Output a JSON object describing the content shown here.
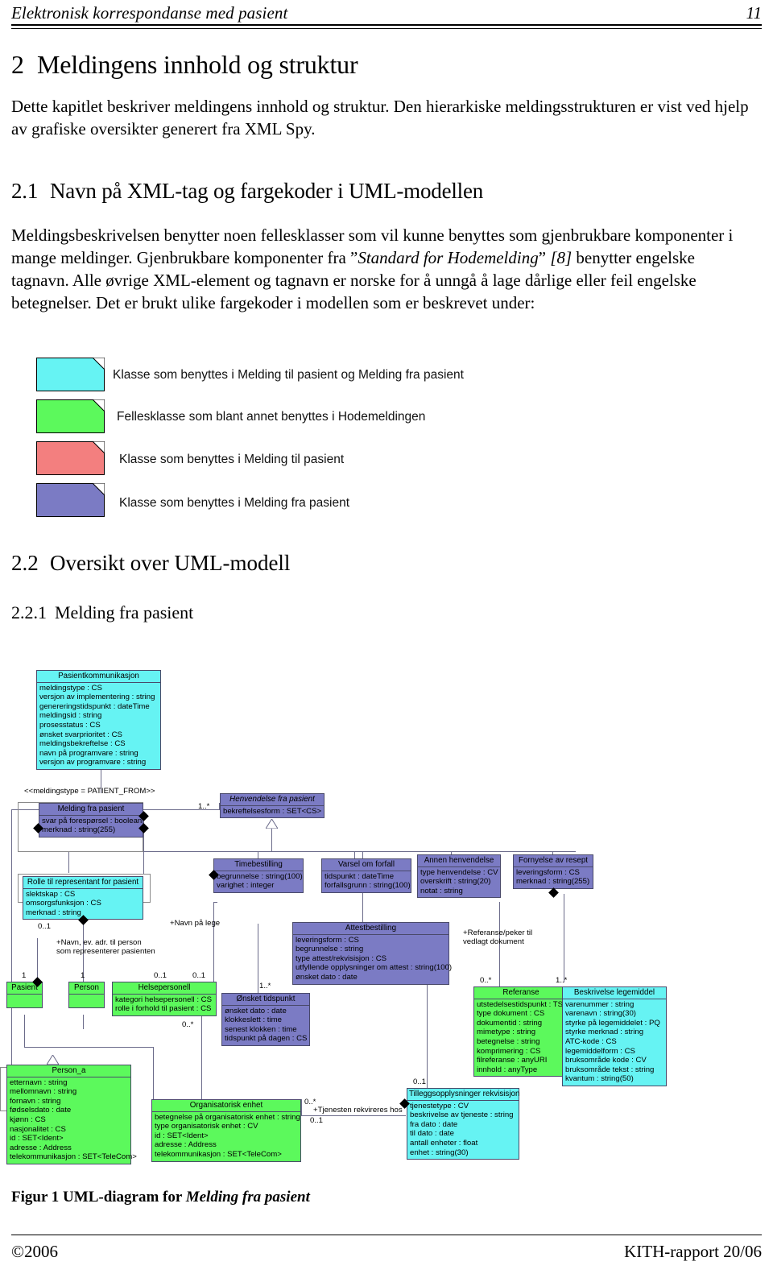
{
  "header": {
    "running_title": "Elektronisk korrespondanse med pasient",
    "page_number": "11"
  },
  "footer": {
    "copyright": "©2006",
    "report_id": "KITH-rapport 20/06"
  },
  "sections": {
    "h1_number": "2",
    "h1_title": "Meldingens innhold og struktur",
    "intro": "Dette kapitlet beskriver meldingens innhold og struktur. Den hierarkiske meldingsstrukturen er vist ved hjelp av grafiske oversikter generert fra XML Spy.",
    "h2_number": "2.1",
    "h2_title": "Navn på XML-tag og fargekoder i UML-modellen",
    "p21_a": "Meldingsbeskrivelsen benytter noen fellesklasser som vil kunne benyttes som gjenbrukbare komponenter i mange meldinger. Gjenbrukbare komponenter fra ”",
    "p21_i1": "Standard for Hodemelding",
    "p21_b": "” ",
    "p21_i2": "[8]",
    "p21_c": " benytter engelske tagnavn. Alle øvrige XML-element og tagnavn er norske for å unngå å lage dårlige eller feil engelske betegnelser. Det er brukt ulike fargekoder i modellen som er beskrevet under:",
    "h2b_number": "2.2",
    "h2b_title": "Oversikt over UML-modell",
    "h3_number": "2.2.1",
    "h3_title": "Melding fra pasient"
  },
  "legend": {
    "items": [
      {
        "color": "#66f3f3",
        "label": "Klasse som benyttes i Melding til pasient og Melding fra pasient"
      },
      {
        "color": "#5cf95c",
        "label": "Fellesklasse som blant annet benyttes i Hodemeldingen"
      },
      {
        "color": "#f37f7f",
        "label": "Klasse som benyttes i Melding til pasient"
      },
      {
        "color": "#7b7bc4",
        "label": "Klasse som benyttes i Melding fra pasient"
      }
    ]
  },
  "figure": {
    "caption_prefix": "Figur 1 UML-diagram for ",
    "caption_italic": "Melding fra pasient"
  },
  "uml": {
    "stereotype": "<<meldingstype = PATIENT_FROM>>",
    "classes": {
      "pasientkommunikasjon": {
        "name": "Pasientkommunikasjon",
        "attrs": [
          "meldingstype : CS",
          "versjon av implementering : string",
          "genereringstidspunkt : dateTime",
          "meldingsid : string",
          "prosesstatus : CS",
          "ønsket svarprioritet : CS",
          "meldingsbekreftelse : CS",
          "navn på programvare : string",
          "versjon av programvare : string"
        ]
      },
      "melding_fra_pasient": {
        "name": "Melding fra pasient",
        "attrs": [
          "svar på forespørsel : boolean",
          "merknad : string(255)"
        ]
      },
      "henvendelse_fra_pasient": {
        "name": "Henvendelse fra pasient",
        "attrs": [
          "bekreftelsesform : SET<CS>"
        ]
      },
      "timebestilling": {
        "name": "Timebestilling",
        "attrs": [
          "begrunnelse : string(100)",
          "varighet : integer"
        ]
      },
      "varsel_om_forfall": {
        "name": "Varsel om forfall",
        "attrs": [
          "tidspunkt : dateTime",
          "forfallsgrunn : string(100)"
        ]
      },
      "annen_henvendelse": {
        "name": "Annen henvendelse",
        "attrs": [
          "type henvendelse : CV",
          "overskrift : string(20)",
          "notat : string"
        ]
      },
      "fornyelse_av_resept": {
        "name": "Fornyelse av resept",
        "attrs": [
          "leveringsform : CS",
          "merknad : string(255)"
        ]
      },
      "rolle_til_representant": {
        "name": "Rolle til representant for pasient",
        "attrs": [
          "slektskap : CS",
          "omsorgsfunksjon : CS",
          "merknad : string"
        ]
      },
      "attestbestilling": {
        "name": "Attestbestilling",
        "attrs": [
          "leveringsform : CS",
          "begrunnelse : string",
          "type attest/rekvisisjon : CS",
          "utfyllende opplysninger om attest : string(100)",
          "ønsket dato : date"
        ]
      },
      "pasient": {
        "name": "Pasient",
        "attrs": []
      },
      "person": {
        "name": "Person",
        "attrs": []
      },
      "helsepersonell": {
        "name": "Helsepersonell",
        "attrs": [
          "kategori helsepersonell : CS",
          "rolle i forhold til pasient : CS"
        ]
      },
      "onsket_tidspunkt": {
        "name": "Ønsket tidspunkt",
        "attrs": [
          "ønsket dato : date",
          "klokkeslett : time",
          "senest klokken : time",
          "tidspunkt på dagen : CS"
        ]
      },
      "referanse": {
        "name": "Referanse",
        "attrs": [
          "utstedelsestidspunkt : TS",
          "type dokument : CS",
          "dokumentid : string",
          "mimetype : string",
          "betegnelse : string",
          "komprimering : CS",
          "filreferanse : anyURI",
          "innhold : anyType"
        ]
      },
      "beskrivelse_legemiddel": {
        "name": "Beskrivelse legemiddel",
        "attrs": [
          "varenummer : string",
          "varenavn : string(30)",
          "styrke på legemiddelet : PQ",
          "styrke merknad : string",
          "ATC-kode : CS",
          "legemiddelform : CS",
          "bruksområde kode : CV",
          "bruksområde tekst : string",
          "kvantum : string(50)"
        ]
      },
      "person_a": {
        "name": "Person_a",
        "attrs": [
          "etternavn : string",
          "mellomnavn : string",
          "fornavn : string",
          "fødselsdato : date",
          "kjønn : CS",
          "nasjonalitet : CS",
          "id : SET<Ident>",
          "adresse : Address",
          "telekommunikasjon : SET<TeleCom>"
        ]
      },
      "organisatorisk_enhet": {
        "name": "Organisatorisk enhet",
        "attrs": [
          "betegnelse på organisatorisk enhet : string",
          "type organisatorisk enhet : CV",
          "id : SET<Ident>",
          "adresse : Address",
          "telekommunikasjon : SET<TeleCom>"
        ]
      },
      "tilleggsopplysninger": {
        "name": "Tilleggsopplysninger rekvisisjon",
        "attrs": [
          "tjenestetype : CV",
          "beskrivelse av tjeneste : string",
          "fra dato : date",
          "til dato : date",
          "antall enheter : float",
          "enhet : string(30)"
        ]
      }
    },
    "multiplicities": {
      "m_henvendelse": "1..*",
      "m_rolle": "0..1",
      "m_pasient": "1",
      "m_person": "1",
      "m_helse_a": "0..1",
      "m_helse_b": "0..1",
      "m_helse_c": "0..*",
      "m_onsket": "1..*",
      "m_referanse": "0..*",
      "m_legemiddel": "1..*",
      "m_tilleggs": "0..1",
      "m_org_a": "0..*",
      "m_org_b": "0..1",
      "m_attest": "0..1"
    },
    "assoc_labels": {
      "navn_pa_lege": "+Navn på lege",
      "navn_person": "+Navn, ev. adr. til person",
      "navn_person_2": "som representerer pasienten",
      "referanse_peker": "+Referanse/peker til",
      "referanse_peker_2": "vedlagt dokument",
      "tjenesten": "+Tjenesten rekvireres hos"
    }
  }
}
